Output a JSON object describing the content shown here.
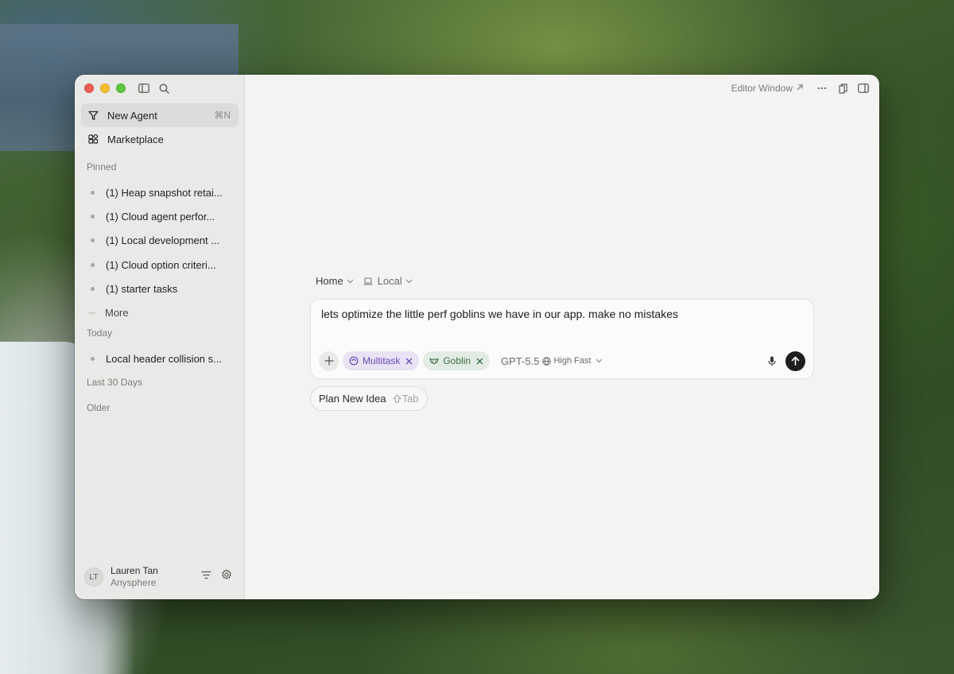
{
  "window": {
    "editor_window_label": "Editor Window"
  },
  "sidebar": {
    "primary": [
      {
        "label": "New Agent",
        "shortcut": "⌘N",
        "icon": "funnel-icon",
        "active": true
      },
      {
        "label": "Marketplace",
        "icon": "apps-grid-icon",
        "active": false
      }
    ],
    "pinned_label": "Pinned",
    "pinned": [
      "(1) Heap snapshot retai...",
      "(1) Cloud agent perfor...",
      "(1) Local development ...",
      "(1) Cloud option criteri...",
      "(1) starter tasks"
    ],
    "more_label": "More",
    "today_label": "Today",
    "today": [
      "Local header collision s..."
    ],
    "last30_label": "Last 30 Days",
    "older_label": "Older",
    "user": {
      "initials": "LT",
      "name": "Lauren Tan",
      "org": "Anysphere"
    }
  },
  "composer": {
    "breadcrumb_home": "Home",
    "breadcrumb_env": "Local",
    "prompt": "lets optimize the little perf goblins we have in our app. make no mistakes",
    "chips": [
      {
        "label": "Multitask",
        "color": "#6b4bb8"
      },
      {
        "label": "Goblin",
        "color": "#3b6e44"
      }
    ],
    "model": "GPT-5.5",
    "effort": "High Fast",
    "plan_label": "Plan New Idea",
    "plan_hint": "Tab",
    "send_color": "#1e1e1e"
  }
}
